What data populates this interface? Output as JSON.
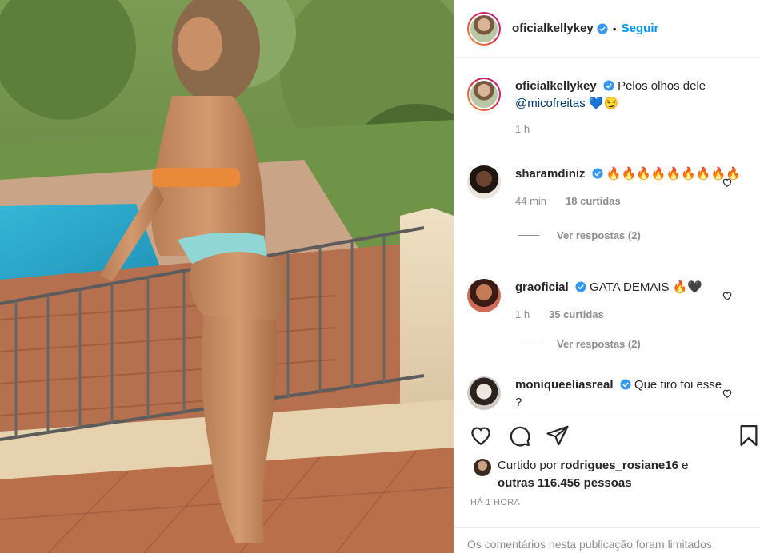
{
  "post": {
    "author": "oficialkellykey",
    "follow_label": "Seguir",
    "separator": "•"
  },
  "caption": {
    "username": "oficialkellykey",
    "text": "Pelos olhos dele",
    "mention": "@micofreitas",
    "emoji": "💙😏",
    "time": "1 h"
  },
  "comments": [
    {
      "username": "sharamdiniz",
      "text": "🔥🔥🔥🔥🔥🔥🔥🔥🔥",
      "time": "44 min",
      "likes": "18 curtidas",
      "replies": "Ver respostas (2)"
    },
    {
      "username": "graoficial",
      "text": "GATA DEMAIS 🔥🖤",
      "time": "1 h",
      "likes": "35 curtidas",
      "replies": "Ver respostas (2)"
    },
    {
      "username": "moniqueeliasreal",
      "text": "Que tiro foi esse ?"
    }
  ],
  "likes": {
    "prefix": "Curtido por",
    "user": "rodrigues_rosiane16",
    "conj": "e",
    "others": "outras 116.456 pessoas"
  },
  "timestamp": "HÁ 1 HORA",
  "comments_limited": "Os comentários nesta publicação foram limitados",
  "icons": [
    "heart-icon",
    "comment-icon",
    "share-icon",
    "bookmark-icon",
    "verified-icon",
    "small-heart-icon"
  ],
  "colors": {
    "accent": "#0095f6",
    "verified": "#3897f0",
    "muted": "#8e8e8e",
    "text": "#262626"
  }
}
